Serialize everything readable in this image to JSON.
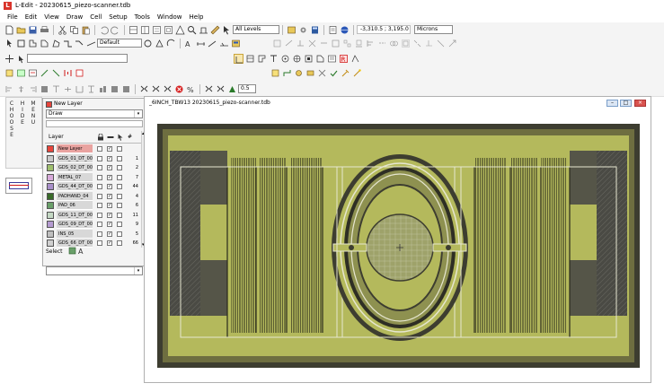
{
  "app": {
    "logo_letter": "L",
    "title": "L-Edit - 20230615_piezo-scanner.tdb"
  },
  "menu": [
    "File",
    "Edit",
    "View",
    "Draw",
    "Cell",
    "Setup",
    "Tools",
    "Window",
    "Help"
  ],
  "toolbar": {
    "layer_filter": "All Levels",
    "coordinates": "-3,310.5 ; 3,195.0",
    "units": "Microns",
    "style_default": "Default",
    "grid_value": "0.5"
  },
  "side_tabs": {
    "choose": "C\nH\nO\nO\nS\nE",
    "hide": "H\nI\nD\nE",
    "menu": "M\nE\nN\nU"
  },
  "layer_palette": {
    "current_layer": "New Layer",
    "mode": "Draw",
    "col_layer": "Layer",
    "col_count": "#",
    "select_label": "Select",
    "layers": [
      {
        "name": "New Layer",
        "color": "#e8453c",
        "v1": false,
        "v2": true,
        "v3": false,
        "count": ""
      },
      {
        "name": "GDS_01_DT_00",
        "color": "#c9c9c9",
        "v1": false,
        "v2": true,
        "v3": false,
        "count": "1"
      },
      {
        "name": "GDS_02_DT_00",
        "color": "#9fbf6e",
        "v1": false,
        "v2": true,
        "v3": false,
        "count": "2"
      },
      {
        "name": "METAL_07",
        "color": "#d7a9d9",
        "v1": false,
        "v2": true,
        "v3": false,
        "count": "7"
      },
      {
        "name": "GDS_44_DT_00",
        "color": "#a88fc9",
        "v1": false,
        "v2": true,
        "v3": false,
        "count": "44"
      },
      {
        "name": "PADHAND_04",
        "color": "#3a6b2a",
        "v1": false,
        "v2": true,
        "v3": false,
        "count": "4"
      },
      {
        "name": "PAD_06",
        "color": "#6aa06a",
        "v1": false,
        "v2": true,
        "v3": false,
        "count": "6"
      },
      {
        "name": "GDS_11_DT_00",
        "color": "#c4d8c4",
        "v1": false,
        "v2": true,
        "v3": false,
        "count": "11"
      },
      {
        "name": "GDS_09_DT_00",
        "color": "#b59bd1",
        "v1": false,
        "v2": true,
        "v3": false,
        "count": "9"
      },
      {
        "name": "INS_05",
        "color": "#bfbfbf",
        "v1": false,
        "v2": true,
        "v3": false,
        "count": "5"
      },
      {
        "name": "GDS_66_DT_00",
        "color": "#d0d0d0",
        "v1": false,
        "v2": true,
        "v3": false,
        "count": "66"
      }
    ]
  },
  "document": {
    "title": "_6INCH_TBW13   20230615_piezo-scanner.tdb",
    "colors": {
      "background": "#3d3d30",
      "die": "#b4b95c",
      "die_dark": "#58582e",
      "accent": "#e6e6d0"
    }
  }
}
